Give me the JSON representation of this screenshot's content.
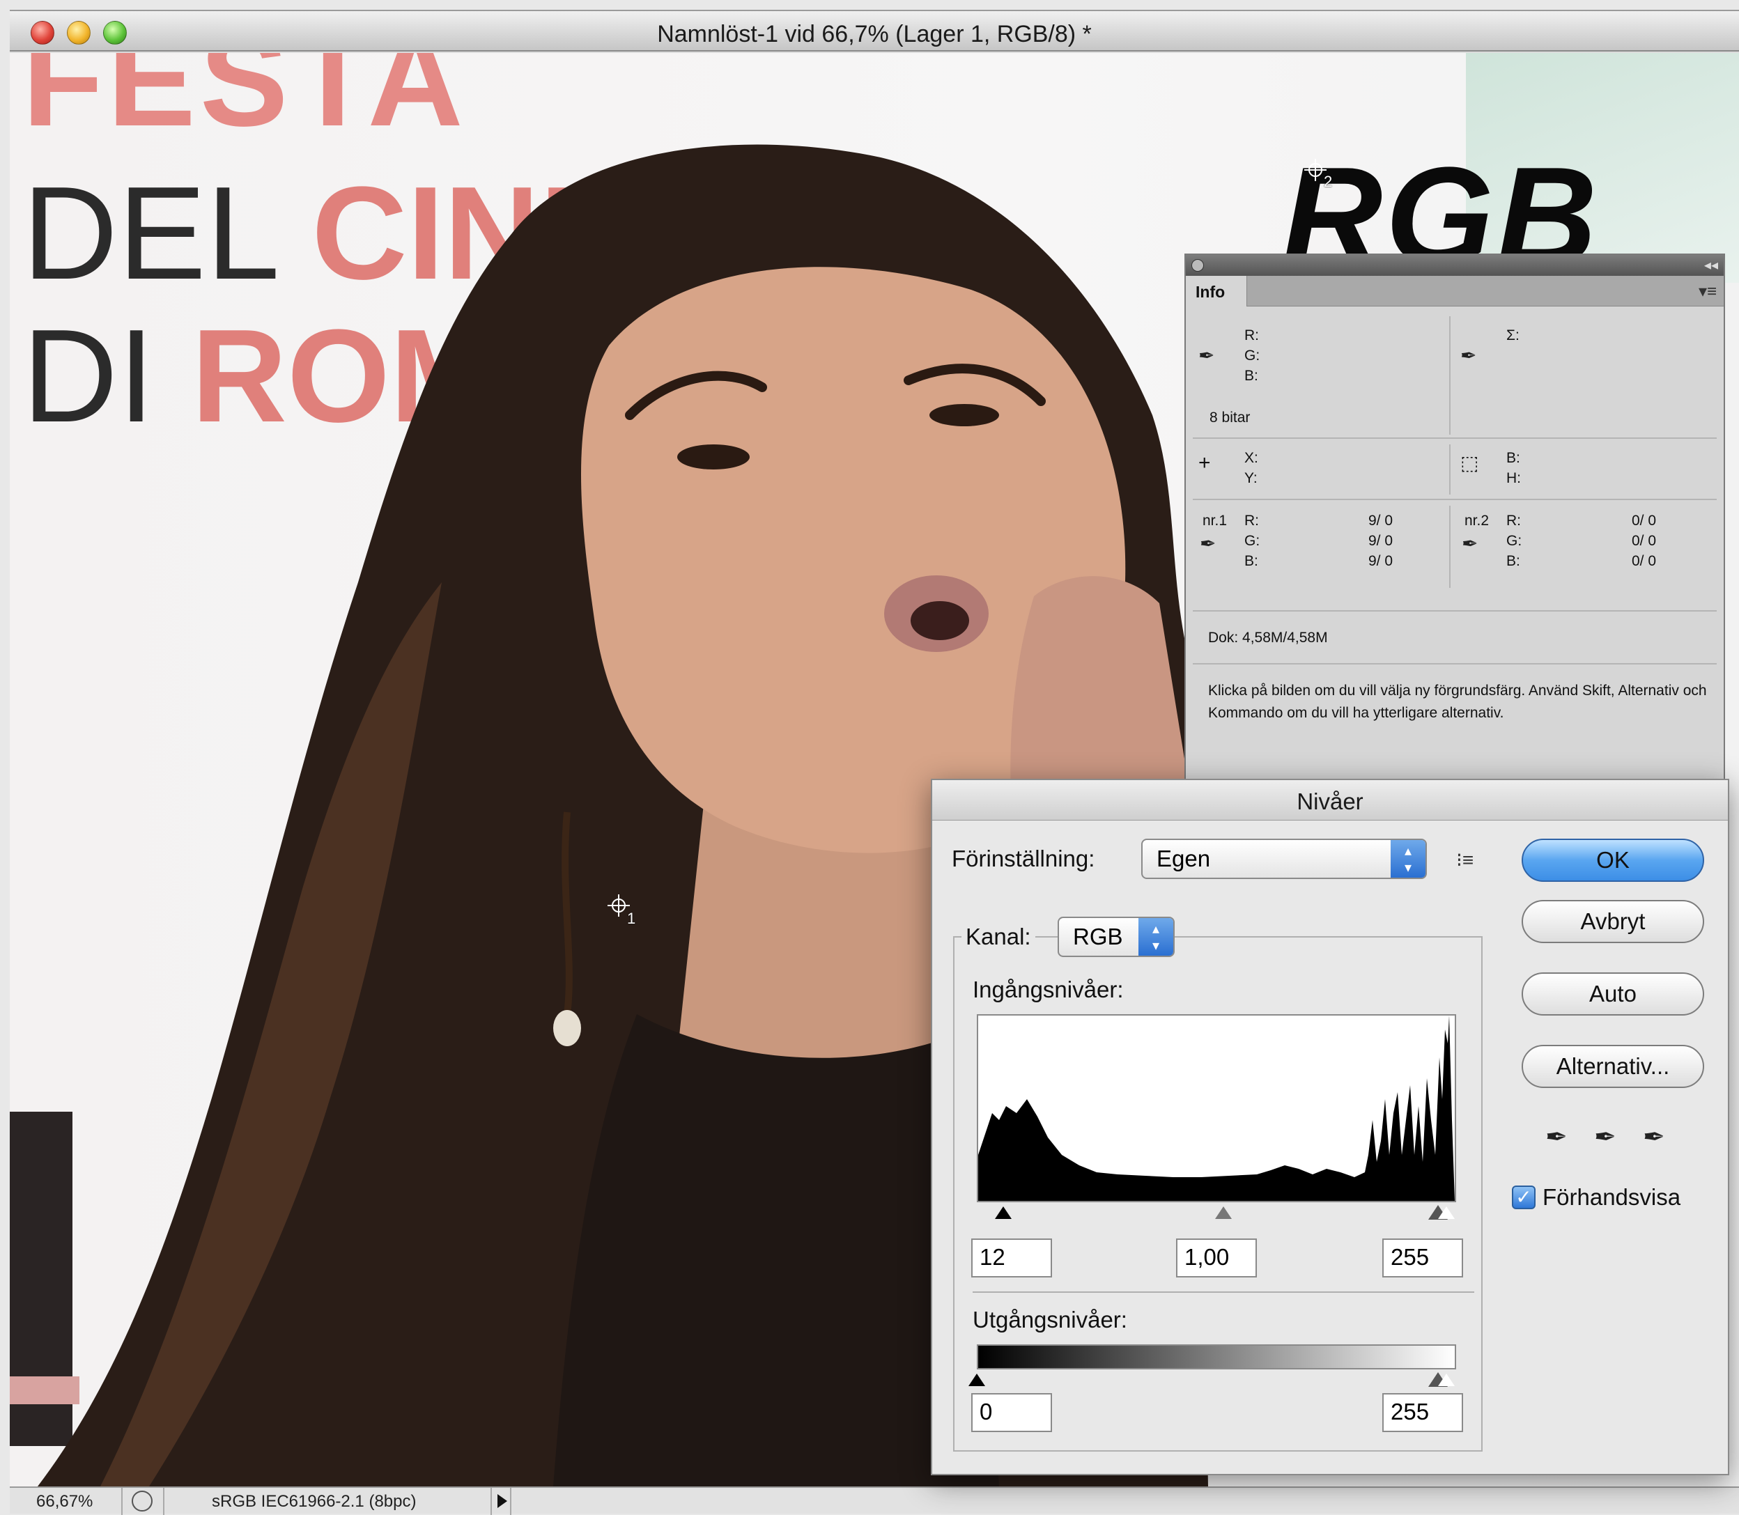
{
  "window": {
    "title": "Namnlöst-1 vid 66,7% (Lager 1, RGB/8) *"
  },
  "canvas": {
    "poster_line_1": "FESTA",
    "poster_line_2_a": "DEL ",
    "poster_line_2_b": "CINE",
    "poster_line_3_a": "DI ",
    "poster_line_3_b": "ROMA",
    "overlay_label": "RGB",
    "sampler_1_label": "1",
    "sampler_2_label": "2"
  },
  "statusbar": {
    "zoom": "66,67%",
    "profile": "sRGB IEC61966-2.1 (8bpc)"
  },
  "info_panel": {
    "tab": "Info",
    "rgb_labels": [
      "R:",
      "G:",
      "B:"
    ],
    "sigma_label": "Σ:",
    "bit_depth": "8 bitar",
    "xy_labels": [
      "X:",
      "Y:"
    ],
    "bh_labels": [
      "B:",
      "H:"
    ],
    "sampler_1": {
      "name": "nr.1",
      "labels": [
        "R:",
        "G:",
        "B:"
      ],
      "values": [
        "9/   0",
        "9/   0",
        "9/   0"
      ]
    },
    "sampler_2": {
      "name": "nr.2",
      "labels": [
        "R:",
        "G:",
        "B:"
      ],
      "values": [
        "0/   0",
        "0/   0",
        "0/   0"
      ]
    },
    "doc_size": "Dok: 4,58M/4,58M",
    "help_text": "Klicka på bilden om du vill välja ny förgrundsfärg.  Använd Skift, Alternativ och Kommando om du vill ha ytterligare alternativ."
  },
  "levels_dialog": {
    "title": "Nivåer",
    "preset_label": "Förinställning:",
    "preset_value": "Egen",
    "channel_label": "Kanal:",
    "channel_value": "RGB",
    "input_levels_label": "Ingångsnivåer:",
    "input_black": "12",
    "input_gamma": "1,00",
    "input_white": "255",
    "output_levels_label": "Utgångsnivåer:",
    "output_black": "0",
    "output_white": "255",
    "ok_label": "OK",
    "cancel_label": "Avbryt",
    "auto_label": "Auto",
    "options_label": "Alternativ...",
    "preview_label": "Förhandsvisa",
    "preview_checked": true
  },
  "icons": {
    "eyedropper": "eyedropper-icon",
    "crosshair": "crosshair-icon",
    "selection": "selection-size-icon",
    "stepper": "popup-stepper-icon",
    "list": "preset-list-icon",
    "checkmark": "checkmark-icon"
  },
  "colors": {
    "ok_button": "#3d8ee6",
    "poster_red": "#e0807b"
  }
}
